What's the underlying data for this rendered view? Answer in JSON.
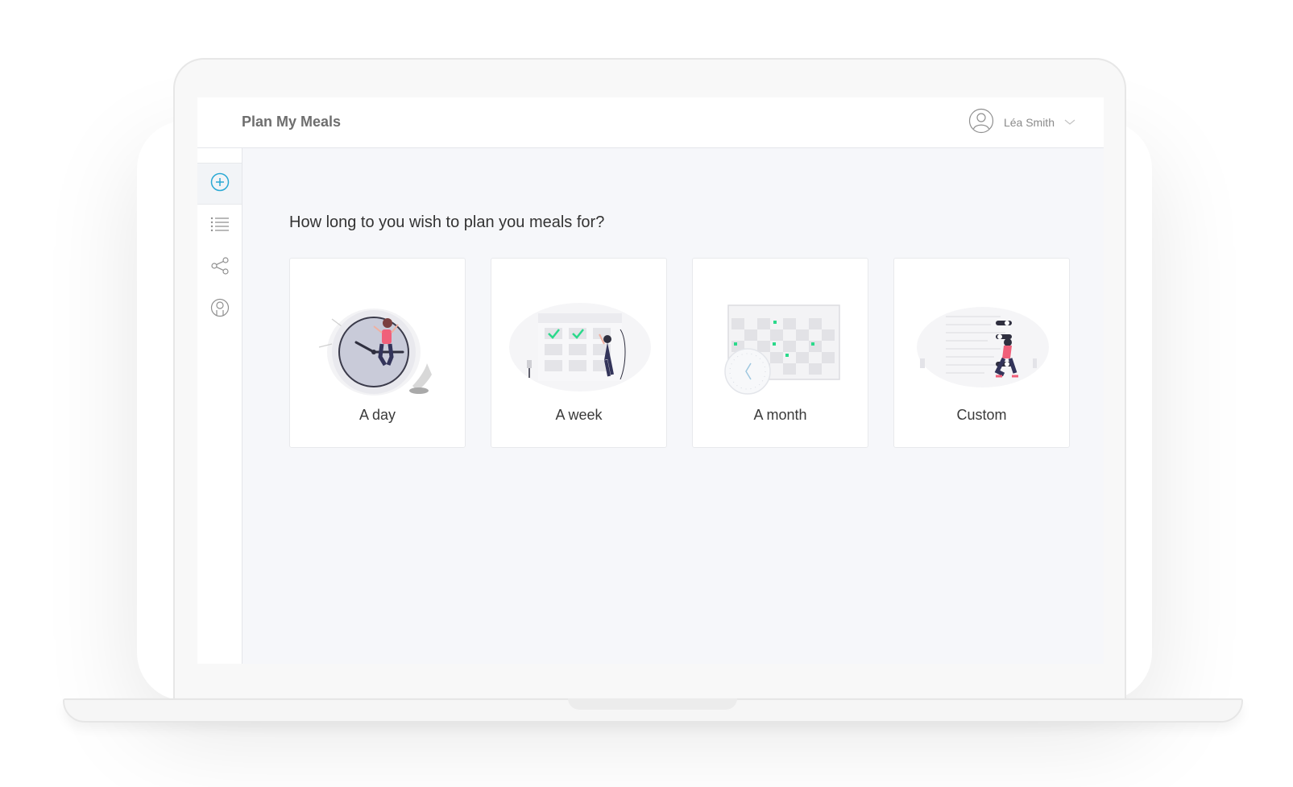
{
  "app": {
    "title": "Plan My Meals"
  },
  "user": {
    "name": "Léa Smith"
  },
  "sidebar": {
    "items": [
      {
        "icon": "add-circle-icon",
        "active": true
      },
      {
        "icon": "list-icon",
        "active": false
      },
      {
        "icon": "share-icon",
        "active": false
      },
      {
        "icon": "user-circle-icon",
        "active": false
      }
    ]
  },
  "main": {
    "question": "How long to you wish to plan you meals for?",
    "options": [
      {
        "label": "A day",
        "icon": "clock-illustration"
      },
      {
        "label": "A week",
        "icon": "calendar-week-illustration"
      },
      {
        "label": "A month",
        "icon": "calendar-month-illustration"
      },
      {
        "label": "Custom",
        "icon": "custom-toggles-illustration"
      }
    ]
  },
  "colors": {
    "accent": "#29a8d4",
    "check_green": "#2bd98b",
    "figure_pink": "#f0607a",
    "figure_navy": "#33345a",
    "background": "#f6f7fa"
  }
}
